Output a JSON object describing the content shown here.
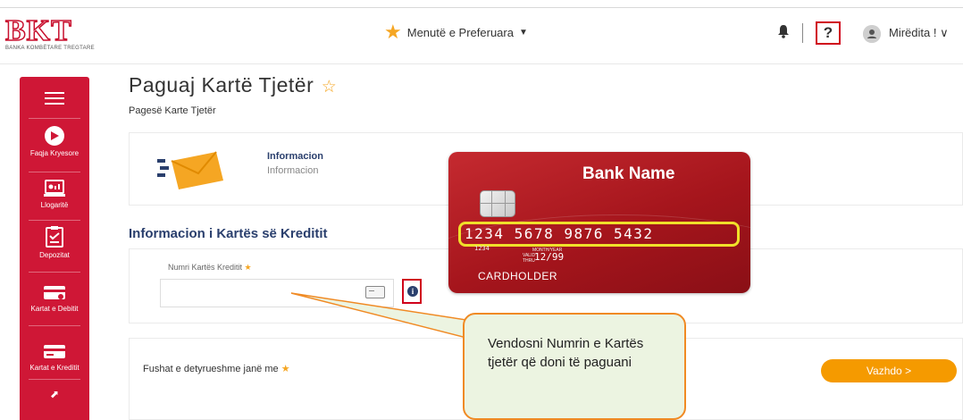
{
  "header": {
    "logo_text": "BKT",
    "logo_subtitle": "BANKA KOMBËTARE TREGTARE",
    "favorites_label": "Menutë e Preferuara",
    "help_label": "?",
    "greeting": "Mirëdita ! ∨"
  },
  "sidebar": {
    "items": [
      {
        "label": "Faqja Kryesore",
        "icon": "home-icon"
      },
      {
        "label": "Llogaritë",
        "icon": "accounts-icon"
      },
      {
        "label": "Depozitat",
        "icon": "deposits-icon"
      },
      {
        "label": "Kartat e Debitit",
        "icon": "debit-card-icon"
      },
      {
        "label": "Kartat e Kreditit",
        "icon": "credit-card-icon"
      }
    ]
  },
  "page": {
    "title": "Paguaj Kartë Tjetër",
    "subtitle": "Pagesë Karte Tjetër"
  },
  "info": {
    "title": "Informacion",
    "subtitle": "Informacion"
  },
  "credit_section": {
    "title": "Informacion i Kartës së Kreditit",
    "field_label": "Numri Kartës Kreditit",
    "field_value": ""
  },
  "footer": {
    "required_note": "Fushat e detyrueshme janë me",
    "next_button": "Vazhdo >"
  },
  "card_image": {
    "bank_name": "Bank Name",
    "number": "1234  5678  9876  5432",
    "small_number": "1234",
    "valid_label": "VALID THRU",
    "month_year_label": "MONTH/YEAR",
    "expiry": "12/99",
    "holder": "CARDHOLDER"
  },
  "callout": {
    "text": "Vendosni Numrin e Kartës tjetër që doni të paguani"
  },
  "colors": {
    "brand_red": "#cf1736",
    "accent_orange": "#f59a00",
    "heading_navy": "#2a3f6d",
    "highlight_yellow": "#f0e02a"
  }
}
